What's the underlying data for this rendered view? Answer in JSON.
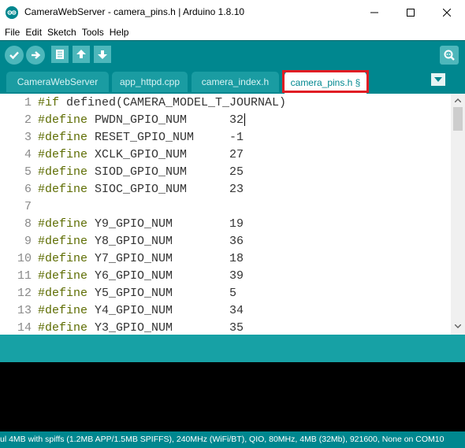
{
  "window": {
    "title": "CameraWebServer - camera_pins.h | Arduino 1.8.10",
    "logo_icon": "arduino-logo-icon",
    "controls": [
      "minimize-icon",
      "maximize-icon",
      "close-icon"
    ]
  },
  "menu": {
    "items": [
      "File",
      "Edit",
      "Sketch",
      "Tools",
      "Help"
    ]
  },
  "toolbar": {
    "buttons": [
      {
        "name": "verify-button",
        "icon": "checkmark-icon"
      },
      {
        "name": "upload-button",
        "icon": "arrow-right-icon"
      },
      {
        "name": "new-button",
        "icon": "new-file-icon"
      },
      {
        "name": "open-button",
        "icon": "arrow-up-icon"
      },
      {
        "name": "save-button",
        "icon": "arrow-down-icon"
      }
    ],
    "serial_monitor_icon": "serial-monitor-icon"
  },
  "tabs": [
    {
      "label": "CameraWebServer",
      "active": false
    },
    {
      "label": "app_httpd.cpp",
      "active": false
    },
    {
      "label": "camera_index.h",
      "active": false
    },
    {
      "label": "camera_pins.h §",
      "active": true
    }
  ],
  "editor": {
    "lines": [
      {
        "num": "1",
        "keyword": "#if",
        "text": " defined(CAMERA_MODEL_T_JOURNAL)"
      },
      {
        "num": "2",
        "keyword": "#define",
        "text": " PWDN_GPIO_NUM      32"
      },
      {
        "num": "3",
        "keyword": "#define",
        "text": " RESET_GPIO_NUM     -1"
      },
      {
        "num": "4",
        "keyword": "#define",
        "text": " XCLK_GPIO_NUM      27"
      },
      {
        "num": "5",
        "keyword": "#define",
        "text": " SIOD_GPIO_NUM      25"
      },
      {
        "num": "6",
        "keyword": "#define",
        "text": " SIOC_GPIO_NUM      23"
      },
      {
        "num": "7",
        "keyword": "",
        "text": ""
      },
      {
        "num": "8",
        "keyword": "#define",
        "text": " Y9_GPIO_NUM        19"
      },
      {
        "num": "9",
        "keyword": "#define",
        "text": " Y8_GPIO_NUM        36"
      },
      {
        "num": "10",
        "keyword": "#define",
        "text": " Y7_GPIO_NUM        18"
      },
      {
        "num": "11",
        "keyword": "#define",
        "text": " Y6_GPIO_NUM        39"
      },
      {
        "num": "12",
        "keyword": "#define",
        "text": " Y5_GPIO_NUM        5"
      },
      {
        "num": "13",
        "keyword": "#define",
        "text": " Y4_GPIO_NUM        34"
      },
      {
        "num": "14",
        "keyword": "#define",
        "text": " Y3_GPIO_NUM        35"
      }
    ]
  },
  "board_info": "ul 4MB with spiffs (1.2MB APP/1.5MB SPIFFS), 240MHz (WiFi/BT), QIO, 80MHz, 4MB (32Mb), 921600, None on COM10",
  "colors": {
    "accent": "#00878f",
    "keyword": "#5e6d03",
    "highlight_box": "#e01d24"
  }
}
